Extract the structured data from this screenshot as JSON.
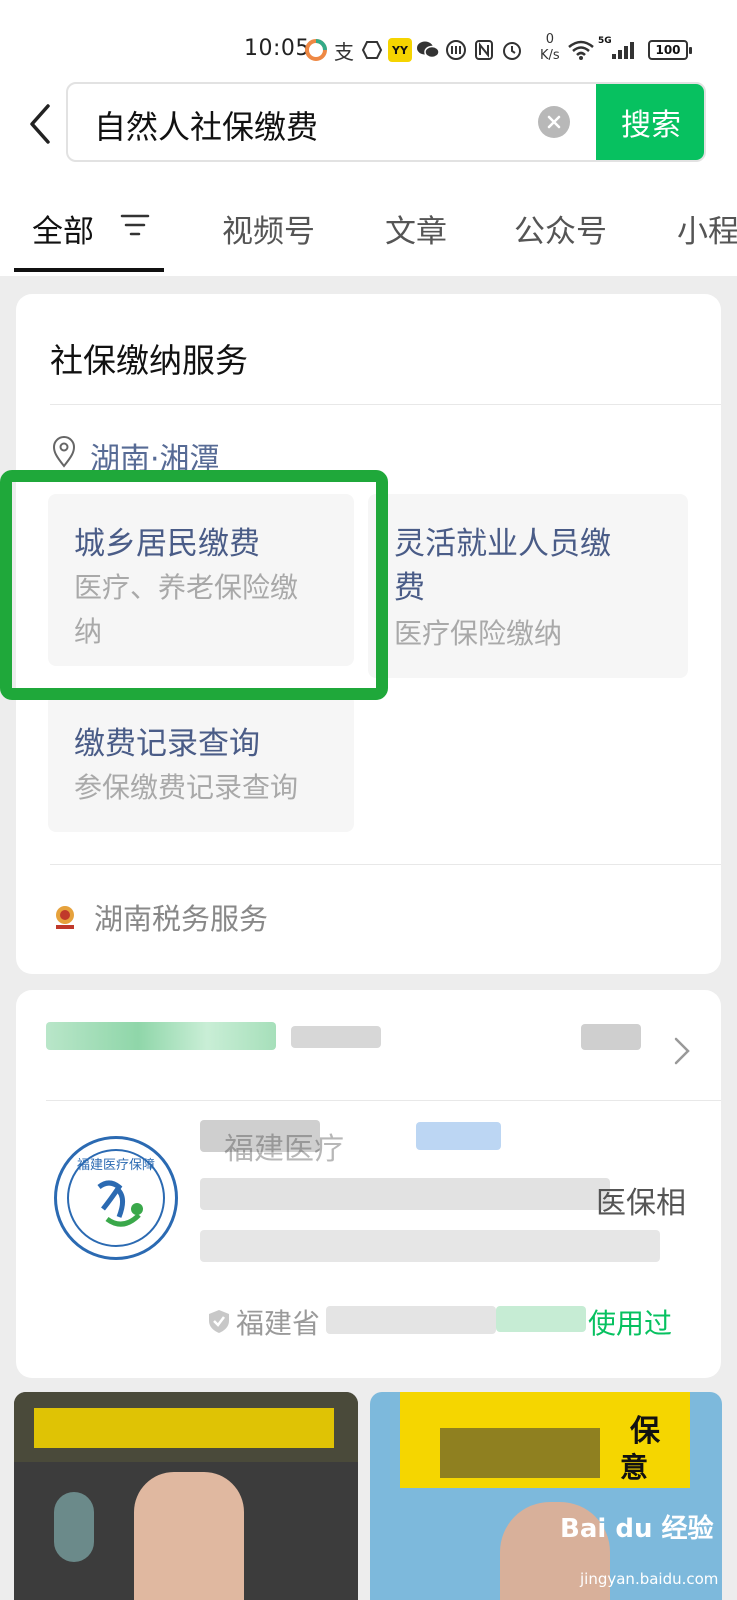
{
  "status_bar": {
    "time": "10:05",
    "net_speed_value": "0",
    "net_speed_unit": "K/s",
    "network": "5G",
    "battery": "100"
  },
  "search": {
    "query": "自然人社保缴费",
    "button_label": "搜索"
  },
  "tabs": [
    {
      "label": "全部",
      "active": true
    },
    {
      "label": "视频号"
    },
    {
      "label": "文章"
    },
    {
      "label": "公众号"
    },
    {
      "label": "小程"
    }
  ],
  "service_card": {
    "title": "社保缴纳服务",
    "location": "湖南·湘潭",
    "items": [
      {
        "title": "城乡居民缴费",
        "subtitle_line1": "医疗、养老保险缴",
        "subtitle_line2": "纳"
      },
      {
        "title_line1": "灵活就业人员缴",
        "title_line2": "费",
        "subtitle": "医疗保险缴纳"
      },
      {
        "title": "缴费记录查询",
        "subtitle": "参保缴费记录查询"
      }
    ],
    "provider": "湖南税务服务"
  },
  "mini_program_card": {
    "name_partial": "福建医疗",
    "desc_partial": "医保相",
    "source_partial": "福建省",
    "used_partial": "使用过",
    "logo_text": "福建医疗保障"
  },
  "bottom_thumbs": {
    "left_overlay": "",
    "right_overlay_end": "保",
    "right_overlay_end2": "意"
  },
  "watermark": {
    "brand": "Bai du 经验",
    "url": "jingyan.baidu.com"
  },
  "colors": {
    "wechat_green": "#07c160",
    "link_blue": "#576b95",
    "highlight_green": "#1fa83a"
  }
}
